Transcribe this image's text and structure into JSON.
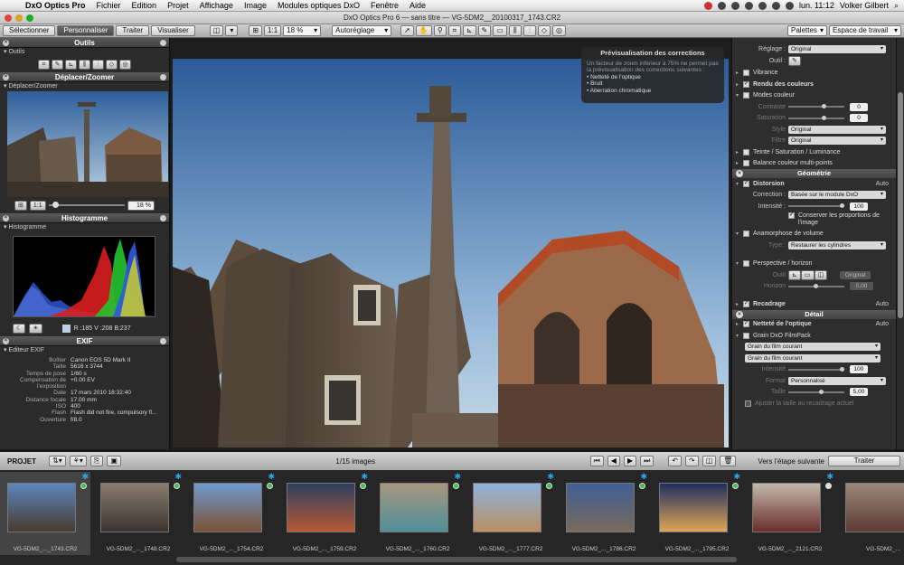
{
  "menubar": {
    "app": "DxO Optics Pro",
    "items": [
      "Fichier",
      "Edition",
      "Projet",
      "Affichage",
      "Image",
      "Modules optiques DxO",
      "Fenêtre",
      "Aide"
    ],
    "time": "lun. 11:12",
    "user": "Volker Gilbert"
  },
  "window": {
    "title": "DxO Optics Pro 6 — sans titre — VG-5DM2__20100317_1743.CR2"
  },
  "toolbar": {
    "tabs": [
      "Sélectionner",
      "Personnaliser",
      "Traiter",
      "Visualiser"
    ],
    "active_tab": "Personnaliser",
    "zoom_fit": "1:1",
    "zoom_value": "18 %",
    "autoreglage": "Autoréglage",
    "palettes": "Palettes",
    "workspace": "Espace de travail"
  },
  "left": {
    "outils": {
      "header": "Outils",
      "sub": "Outils"
    },
    "deplacer": {
      "header": "Déplacer/Zoomer",
      "sub": "Déplacer/Zoomer",
      "ratio": "1:1",
      "zoom": "18 %"
    },
    "histogramme": {
      "header": "Histogramme",
      "sub": "Histogramme",
      "rgb": "R :185 V :208 B:237"
    },
    "exif": {
      "header": "EXIF",
      "sub": "Editeur EXIF",
      "rows": [
        {
          "k": "Boîtier",
          "v": "Canon EOS 5D Mark II"
        },
        {
          "k": "Taille",
          "v": "5616 x 3744"
        },
        {
          "k": "Temps de pose",
          "v": "1/60 s"
        },
        {
          "k": "Compensation de l'exposition",
          "v": "+0.00 EV"
        },
        {
          "k": "Date",
          "v": "17 mars 2010 18:32:40"
        },
        {
          "k": "Distance focale",
          "v": "17.00 mm"
        },
        {
          "k": "ISO",
          "v": "400"
        },
        {
          "k": "Flash",
          "v": "Flash did not fire, compulsory fl..."
        },
        {
          "k": "Ouverture",
          "v": "f/8.0"
        }
      ]
    }
  },
  "preview": {
    "title": "Prévisualisation des corrections",
    "desc": "Un facteur de zoom inférieur à 75% ne permet pas la prévisualisation des corrections suivantes :",
    "items": [
      "Netteté de l'optique",
      "Bruit",
      "Aberration chromatique"
    ]
  },
  "right": {
    "reglage": {
      "label": "Réglage :",
      "value": "Original",
      "outil": "Outil :"
    },
    "vibrance": "Vibrance",
    "rendu": "Rendu des couleurs",
    "modes": "Modes couleur",
    "contraste": {
      "label": "Contraste",
      "value": "0"
    },
    "saturation": {
      "label": "Saturation",
      "value": "0"
    },
    "style": {
      "label": "Style",
      "value": "Original"
    },
    "filtre": {
      "label": "Filtre",
      "value": "Original"
    },
    "teinte": "Teinte / Saturation / Luminance",
    "balance_multi": "Balance couleur multi-points",
    "geometrie": "Géométrie",
    "distorsion": "Distorsion",
    "distorsion_auto": "Auto",
    "correction": {
      "label": "Correction :",
      "value": "Basée sur le module DxO"
    },
    "intensite": {
      "label": "Intensité :",
      "value": "100"
    },
    "conserver": "Conserver les proportions de l'image",
    "anamorphose": "Anamorphose de volume",
    "type": {
      "label": "Type :",
      "value": "Restaurer les cylindres"
    },
    "perspective": "Perspective / horizon",
    "outil2": {
      "label": "Outil",
      "value": "Original"
    },
    "horizon": {
      "label": "Horizon",
      "value": "0,00"
    },
    "recadrage": "Recadrage",
    "recadrage_auto": "Auto",
    "detail": "Détail",
    "nettete": "Netteté de l'optique",
    "nettete_auto": "Auto",
    "grain": "Grain DxO FilmPack",
    "grain_sel1": "Grain du film courant",
    "grain_sel2": "Grain du film courant",
    "grain_intensite": {
      "label": "Intensité",
      "value": "100"
    },
    "format": {
      "label": "Format",
      "value": "Personnalisé"
    },
    "taille": {
      "label": "Taille",
      "value": "5,00"
    },
    "ajuster": "Ajuster la taille au recadrage actuel"
  },
  "bottom": {
    "projet": "PROJET",
    "count": "1/15 images",
    "next": "Vers l'étape suivante",
    "traiter": "Traiter"
  },
  "film": [
    {
      "label": "VG-5DM2_..._1743.CR2",
      "c1": "#5b86bd",
      "c2": "#4a3a30"
    },
    {
      "label": "VG-5DM2_..._1748.CR2",
      "c1": "#8a7d70",
      "c2": "#3b342f"
    },
    {
      "label": "VG-5DM2_..._1754.CR2",
      "c1": "#6f99cc",
      "c2": "#7a5236"
    },
    {
      "label": "VG-5DM2_..._1759.CR2",
      "c1": "#2c3f5f",
      "c2": "#b85a34"
    },
    {
      "label": "VG-5DM2_..._1760.CR2",
      "c1": "#a9967d",
      "c2": "#4e8f9a"
    },
    {
      "label": "VG-5DM2_..._1777.CR2",
      "c1": "#8fb3dc",
      "c2": "#b98e63"
    },
    {
      "label": "VG-5DM2_..._1786.CR2",
      "c1": "#3f5f95",
      "c2": "#7a6a5c"
    },
    {
      "label": "VG-5DM2_..._1795.CR2",
      "c1": "#1f2f60",
      "c2": "#e0a555"
    },
    {
      "label": "VG-5DM2_..._2121.CR2",
      "c1": "#c2b8ac",
      "c2": "#6b2d2a"
    },
    {
      "label": "VG-5DM2_...",
      "c1": "#9c8878",
      "c2": "#5b3a34"
    }
  ]
}
